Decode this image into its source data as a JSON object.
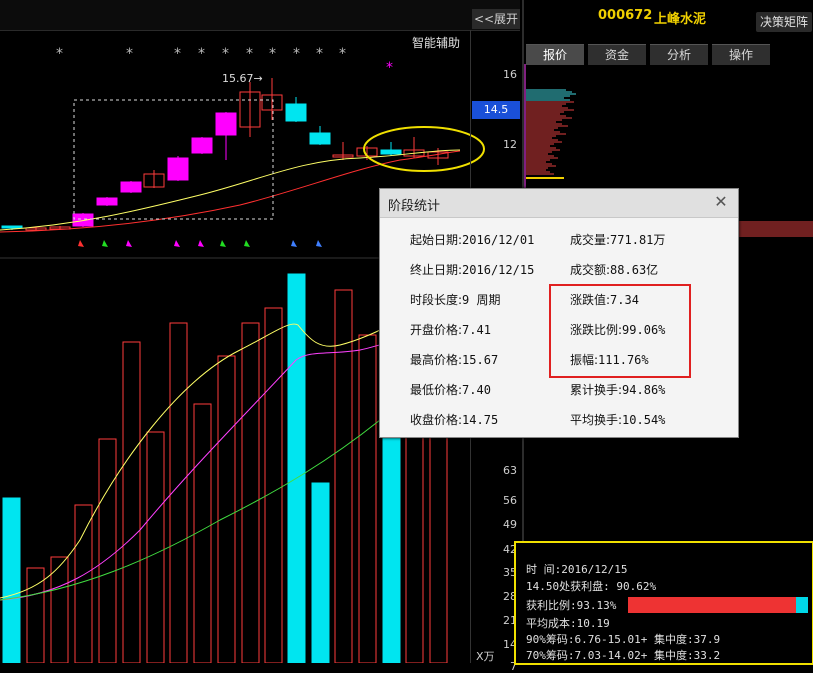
{
  "stock": {
    "code": "000672",
    "name": "上峰水泥"
  },
  "header": {
    "expand_label": "<<展开",
    "assist_label": "智能辅助",
    "decision_label": "决策矩阵"
  },
  "tabs": [
    "报价",
    "资金",
    "分析",
    "操作"
  ],
  "price_axis": {
    "ticks": [
      "16",
      "12"
    ],
    "current": "14.5"
  },
  "volume_axis": {
    "ticks": [
      "63",
      "56",
      "49",
      "42",
      "35",
      "28",
      "21",
      "14",
      "7"
    ],
    "unit": "X万"
  },
  "annotation": {
    "high_label": "15.67→"
  },
  "colors": {
    "up": "#ff3c3c",
    "down": "#00e5f0",
    "magenta": "#ff00ff",
    "highlight": "#f0e000",
    "accent_blue": "#1a50d8"
  },
  "dialog": {
    "title": "阶段统计",
    "left": [
      {
        "label": "起始日期:",
        "value": "2016/12/01"
      },
      {
        "label": "终止日期:",
        "value": "2016/12/15"
      },
      {
        "label": "时段长度:",
        "value": "9 周期"
      },
      {
        "label": "开盘价格:",
        "value": "7.41"
      },
      {
        "label": "最高价格:",
        "value": "15.67"
      },
      {
        "label": "最低价格:",
        "value": "7.40"
      },
      {
        "label": "收盘价格:",
        "value": "14.75"
      }
    ],
    "right": [
      {
        "label": "成交量:",
        "value": "771.81万"
      },
      {
        "label": "成交额:",
        "value": "88.63亿"
      },
      {
        "label": "涨跌值:",
        "value": "7.34"
      },
      {
        "label": "涨跌比例:",
        "value": "99.06%"
      },
      {
        "label": "振幅:",
        "value": "111.76%"
      },
      {
        "label": "累计换手:",
        "value": "94.86%"
      },
      {
        "label": "平均换手:",
        "value": "10.54%"
      }
    ]
  },
  "chips": {
    "time_label": "时        间:2016/12/15",
    "profit_line": "14.50处获利盘: 90.62%",
    "profit_ratio_label": "获利比例:93.13%",
    "profit_ratio": 0.9313,
    "avg_cost": "平均成本:10.19",
    "chip90": "90%筹码:6.76-15.01+ 集中度:37.9",
    "chip70": "70%筹码:7.03-14.02+ 集中度:33.2"
  }
}
